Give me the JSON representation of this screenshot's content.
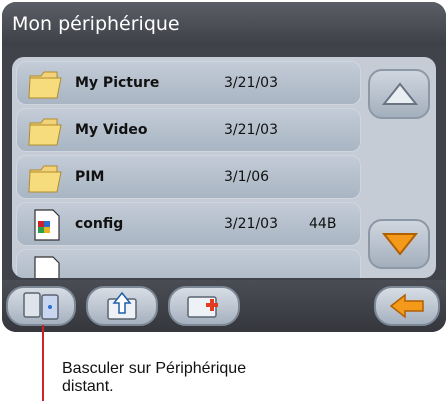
{
  "title": "Mon périphérique",
  "files": [
    {
      "name": "My Picture",
      "date": "3/21/03",
      "size": "",
      "icon": "folder-icon"
    },
    {
      "name": "My Video",
      "date": "3/21/03",
      "size": "",
      "icon": "folder-icon"
    },
    {
      "name": "PIM",
      "date": "3/1/06",
      "size": "",
      "icon": "folder-icon"
    },
    {
      "name": "config",
      "date": "3/21/03",
      "size": "44B",
      "icon": "file-icon"
    }
  ],
  "scroll": {
    "up_icon": "up-arrow-icon",
    "down_icon": "down-arrow-icon"
  },
  "toolbar": {
    "buttons": [
      "switch-device-icon",
      "up-folder-icon",
      "new-folder-icon",
      "back-icon"
    ]
  },
  "callout": {
    "text": "Basculer sur Périphérique\ndistant."
  }
}
